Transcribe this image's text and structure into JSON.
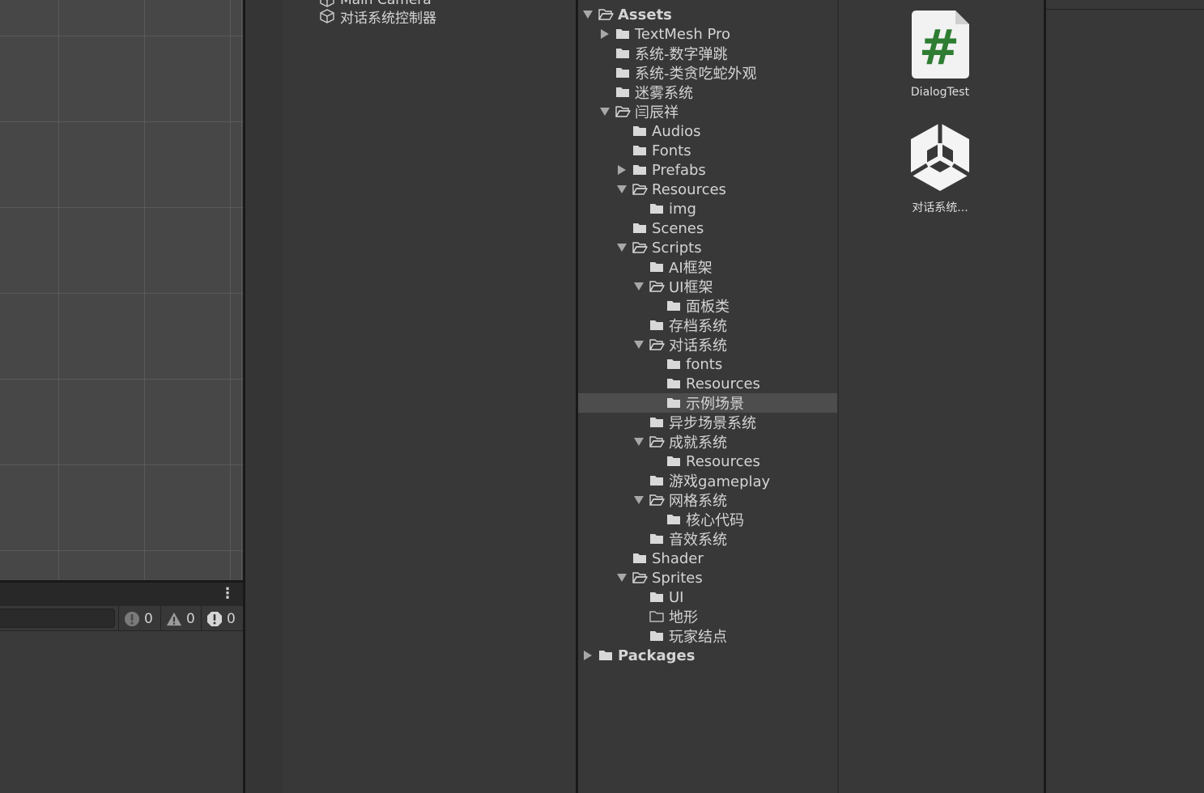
{
  "hierarchy": {
    "items": [
      {
        "label": "Main Camera",
        "icon": "gameobject-cube-icon"
      },
      {
        "label": "对话系统控制器",
        "icon": "gameobject-cube-icon"
      }
    ]
  },
  "console": {
    "info_count": "0",
    "warning_count": "0",
    "error_count": "0",
    "menu_icon": "kebab-menu-icon"
  },
  "project_tree": {
    "items": [
      {
        "label": "Assets",
        "depth": 0,
        "arrow": "down",
        "open": true,
        "bold": true
      },
      {
        "label": "TextMesh Pro",
        "depth": 1,
        "arrow": "right",
        "open": false
      },
      {
        "label": "系统-数字弹跳",
        "depth": 1,
        "arrow": "",
        "open": false
      },
      {
        "label": "系统-类贪吃蛇外观",
        "depth": 1,
        "arrow": "",
        "open": false
      },
      {
        "label": "迷雾系统",
        "depth": 1,
        "arrow": "",
        "open": false
      },
      {
        "label": "闫辰祥",
        "depth": 1,
        "arrow": "down",
        "open": true
      },
      {
        "label": "Audios",
        "depth": 2,
        "arrow": "",
        "open": false
      },
      {
        "label": "Fonts",
        "depth": 2,
        "arrow": "",
        "open": false
      },
      {
        "label": "Prefabs",
        "depth": 2,
        "arrow": "right",
        "open": false
      },
      {
        "label": "Resources",
        "depth": 2,
        "arrow": "down",
        "open": true
      },
      {
        "label": "img",
        "depth": 3,
        "arrow": "",
        "open": false
      },
      {
        "label": "Scenes",
        "depth": 2,
        "arrow": "",
        "open": false
      },
      {
        "label": "Scripts",
        "depth": 2,
        "arrow": "down",
        "open": true
      },
      {
        "label": "AI框架",
        "depth": 3,
        "arrow": "",
        "open": false
      },
      {
        "label": "UI框架",
        "depth": 3,
        "arrow": "down",
        "open": true
      },
      {
        "label": "面板类",
        "depth": 4,
        "arrow": "",
        "open": false
      },
      {
        "label": "存档系统",
        "depth": 3,
        "arrow": "",
        "open": false
      },
      {
        "label": "对话系统",
        "depth": 3,
        "arrow": "down",
        "open": true
      },
      {
        "label": "fonts",
        "depth": 4,
        "arrow": "",
        "open": false
      },
      {
        "label": "Resources",
        "depth": 4,
        "arrow": "",
        "open": false
      },
      {
        "label": "示例场景",
        "depth": 4,
        "arrow": "",
        "open": false,
        "selected": true
      },
      {
        "label": "异步场景系统",
        "depth": 3,
        "arrow": "",
        "open": false
      },
      {
        "label": "成就系统",
        "depth": 3,
        "arrow": "down",
        "open": true
      },
      {
        "label": "Resources",
        "depth": 4,
        "arrow": "",
        "open": false
      },
      {
        "label": "游戏gameplay",
        "depth": 3,
        "arrow": "",
        "open": false
      },
      {
        "label": "网格系统",
        "depth": 3,
        "arrow": "down",
        "open": true
      },
      {
        "label": "核心代码",
        "depth": 4,
        "arrow": "",
        "open": false
      },
      {
        "label": "音效系统",
        "depth": 3,
        "arrow": "",
        "open": false
      },
      {
        "label": "Shader",
        "depth": 2,
        "arrow": "",
        "open": false
      },
      {
        "label": "Sprites",
        "depth": 2,
        "arrow": "down",
        "open": true
      },
      {
        "label": "UI",
        "depth": 3,
        "arrow": "",
        "open": false
      },
      {
        "label": "地形",
        "depth": 3,
        "arrow": "",
        "open": false,
        "empty": true
      },
      {
        "label": "玩家结点",
        "depth": 3,
        "arrow": "",
        "open": false
      },
      {
        "label": "Packages",
        "depth": 0,
        "arrow": "right",
        "open": false,
        "bold": true
      }
    ]
  },
  "assets": [
    {
      "label": "DialogTest",
      "icon": "csharp-script-icon",
      "glyph": "#",
      "color": "#2e7d32"
    },
    {
      "label": "对话系统...",
      "icon": "unity-scene-icon"
    }
  ]
}
